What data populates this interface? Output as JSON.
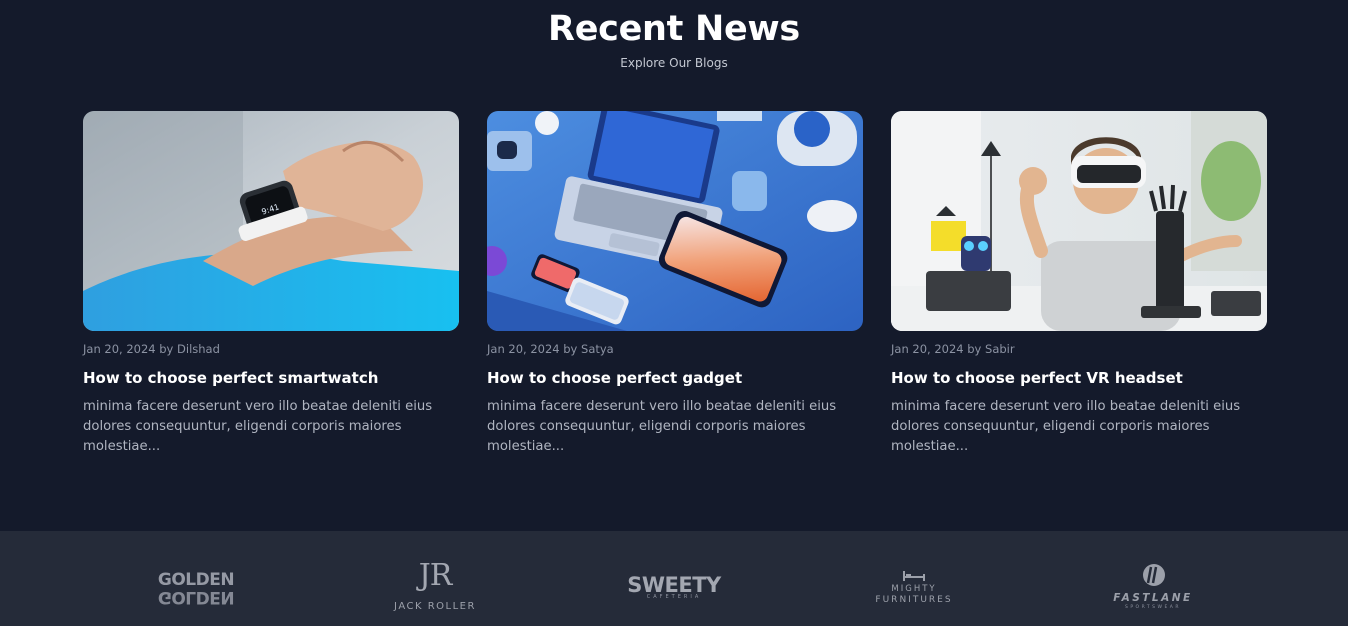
{
  "section": {
    "title": "Recent News",
    "subtitle": "Explore Our Blogs"
  },
  "posts": [
    {
      "image_icon": "smartwatch-photo",
      "date": "Jan 20, 2024",
      "by": "by",
      "author": "Dilshad",
      "title": "How to choose perfect smartwatch",
      "excerpt": "minima facere deserunt vero illo beatae deleniti eius dolores consequuntur, eligendi corporis maiores molestiae..."
    },
    {
      "image_icon": "gadgets-photo",
      "date": "Jan 20, 2024",
      "by": "by",
      "author": "Satya",
      "title": "How to choose perfect gadget",
      "excerpt": "minima facere deserunt vero illo beatae deleniti eius dolores consequuntur, eligendi corporis maiores molestiae..."
    },
    {
      "image_icon": "vr-headset-photo",
      "date": "Jan 20, 2024",
      "by": "by",
      "author": "Sabir",
      "title": "How to choose perfect VR headset",
      "excerpt": "minima facere deserunt vero illo beatae deleniti eius dolores consequuntur, eligendi corporis maiores molestiae..."
    }
  ],
  "brands": [
    {
      "name": "GOLDEN",
      "mirror": "GOLDEN"
    },
    {
      "monogram": "JR",
      "name": "JACK ROLLER"
    },
    {
      "name": "SWEETY",
      "sub": "CAFETERIA"
    },
    {
      "line1": "MIGHTY",
      "line2": "FURNITURES"
    },
    {
      "name": "FASTLANE",
      "sub": "SPORTSWEAR"
    }
  ],
  "colors": {
    "background": "#141a2b",
    "brand_strip": "#252b39",
    "text_primary": "#ffffff",
    "text_muted": "#8c93a3"
  }
}
